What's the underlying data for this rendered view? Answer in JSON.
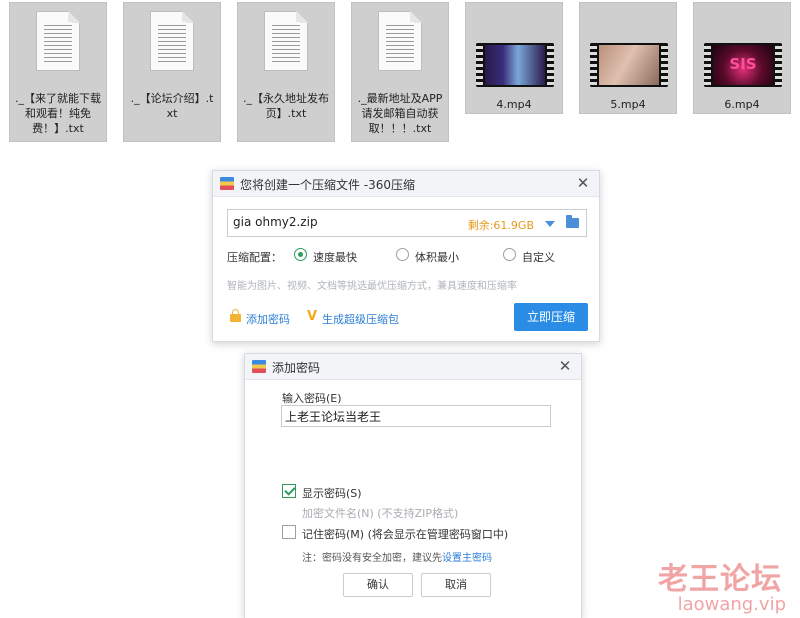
{
  "files": [
    {
      "name": "._【来了就能下载和观看！纯免费！】.txt",
      "type": "txt"
    },
    {
      "name": "._【论坛介绍】.txt",
      "type": "txt"
    },
    {
      "name": "._【永久地址发布页】.txt",
      "type": "txt"
    },
    {
      "name": "._最新地址及APP请发邮箱自动获取！！！.txt",
      "type": "txt"
    },
    {
      "name": "4.mp4",
      "type": "video"
    },
    {
      "name": "5.mp4",
      "type": "video"
    },
    {
      "name": "6.mp4",
      "type": "video"
    }
  ],
  "video_logo_6": "SIS",
  "compress_dialog": {
    "title": "您将创建一个压缩文件 -360压缩",
    "filename": "gia ohmy2.zip",
    "free_space": "剩余:61.9GB",
    "config_label": "压缩配置：",
    "options": [
      "速度最快",
      "体积最小",
      "自定义"
    ],
    "selected_option": "速度最快",
    "hint": "智能为图片、视频、文档等挑选最优压缩方式，兼具速度和压缩率",
    "add_password": "添加密码",
    "super_package": "生成超级压缩包",
    "compress_now": "立即压缩"
  },
  "password_dialog": {
    "title": "添加密码",
    "input_label": "输入密码(E)",
    "password": "上老王论坛当老王",
    "show_password": "显示密码(S)",
    "show_password_checked": true,
    "encrypt_filenames": "加密文件名(N) (不支持ZIP格式)",
    "remember_password": "记住密码(M) (将会显示在管理密码窗口中)",
    "note": "注：密码没有安全加密，建议先",
    "note_link": "设置主密码",
    "ok": "确认",
    "cancel": "取消"
  },
  "watermark": {
    "cn": "老王论坛",
    "en": "laowang.vip"
  },
  "colors": {
    "accent": "#2b8ce6",
    "check": "#2a9d5c",
    "free_space": "#e59a1c"
  }
}
